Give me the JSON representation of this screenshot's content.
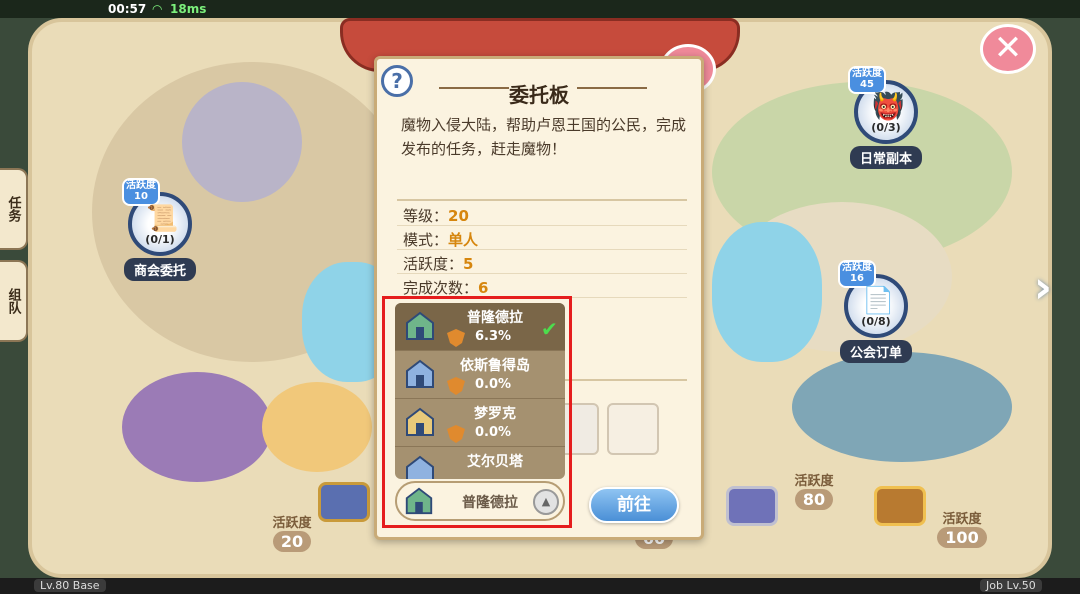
{
  "status": {
    "time": "00:57",
    "ping": "18ms"
  },
  "left_tabs": {
    "task": "任务",
    "team": "组队"
  },
  "nodes": {
    "merchant": {
      "badge_label": "活跃度",
      "badge_value": "10",
      "count": "(0/1)",
      "label": "商会委托"
    },
    "daily": {
      "badge_label": "活跃度",
      "badge_value": "45",
      "count": "(0/3)",
      "label": "日常副本"
    },
    "guild": {
      "badge_label": "活跃度",
      "badge_value": "16",
      "count": "(0/8)",
      "label": "公会订单"
    }
  },
  "activity_chests": [
    {
      "caption": "活跃度",
      "value": "20"
    },
    {
      "caption": "",
      "value": "60"
    },
    {
      "caption": "活跃度",
      "value": "80"
    },
    {
      "caption": "活跃度",
      "value": "100"
    }
  ],
  "dialog": {
    "help": "?",
    "title": "委托板",
    "description": "魔物入侵大陆，帮助卢恩王国的公民，完成发布的任务，赶走魔物！",
    "level_label": "等级：",
    "level_value": "20",
    "mode_label": "模式：",
    "mode_value": "单人",
    "activity_label": "活跃度：",
    "activity_value": "5",
    "completions_label": "完成次数：",
    "completions_value": "6",
    "go_button": "前往"
  },
  "server_dropdown": {
    "options": [
      {
        "name": "普隆德拉",
        "percent": "6.3%",
        "selected": true
      },
      {
        "name": "依斯鲁得岛",
        "percent": "0.0%",
        "selected": false
      },
      {
        "name": "梦罗克",
        "percent": "0.0%",
        "selected": false
      },
      {
        "name": "艾尔贝塔",
        "percent": "",
        "selected": false
      }
    ],
    "selected_value": "普隆德拉",
    "toggle_icon": "▲"
  },
  "bottom": {
    "base_level": "Lv.80 Base",
    "job_level": "Job Lv.50"
  },
  "colors": {
    "accent_blue": "#4a8fd6",
    "highlight_red": "#e51d1d",
    "value_orange": "#d6860e"
  }
}
